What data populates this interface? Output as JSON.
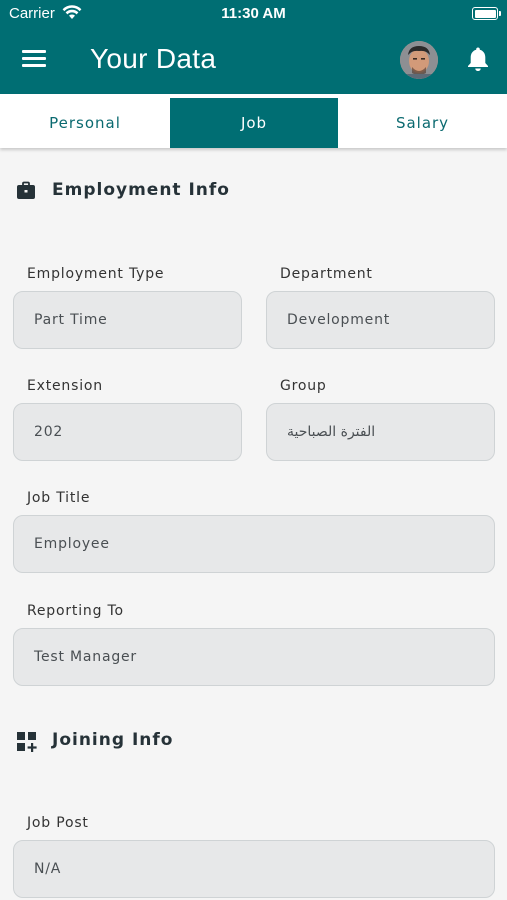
{
  "status_bar": {
    "carrier": "Carrier",
    "time": "11:30 AM"
  },
  "header": {
    "title": "Your Data",
    "menu_icon": "hamburger-menu-icon",
    "notification_icon": "bell-icon"
  },
  "tabs": [
    {
      "label": "Personal",
      "active": false
    },
    {
      "label": "Job",
      "active": true
    },
    {
      "label": "Salary",
      "active": false
    }
  ],
  "employment_info": {
    "title": "Employment Info",
    "icon": "briefcase-icon",
    "fields": {
      "employment_type": {
        "label": "Employment Type",
        "value": "Part Time"
      },
      "department": {
        "label": "Department",
        "value": "Development"
      },
      "extension": {
        "label": "Extension",
        "value": "202"
      },
      "group": {
        "label": "Group",
        "value": "الفترة الصباحية"
      },
      "job_title": {
        "label": "Job Title",
        "value": "Employee"
      },
      "reporting_to": {
        "label": "Reporting To",
        "value": "Test Manager"
      }
    }
  },
  "joining_info": {
    "title": "Joining Info",
    "icon": "add-grid-icon",
    "fields": {
      "job_post": {
        "label": "Job Post",
        "value": "N/A"
      }
    }
  },
  "colors": {
    "primary": "#006e73",
    "field_bg": "#e7e8e9",
    "background": "#f5f5f5"
  }
}
